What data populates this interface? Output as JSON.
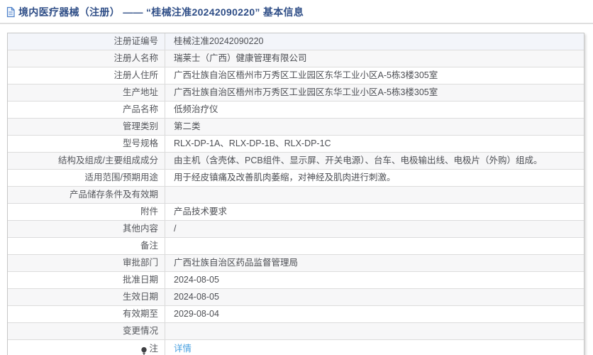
{
  "header": {
    "title": "境内医疗器械（注册） —— “桂械注准20242090220” 基本信息"
  },
  "table": {
    "rows": [
      {
        "label": "注册证编号",
        "value": "桂械注准20242090220"
      },
      {
        "label": "注册人名称",
        "value": "瑞莱士（广西）健康管理有限公司"
      },
      {
        "label": "注册人住所",
        "value": "广西壮族自治区梧州市万秀区工业园区东华工业小区A-5栋3楼305室"
      },
      {
        "label": "生产地址",
        "value": "广西壮族自治区梧州市万秀区工业园区东华工业小区A-5栋3楼305室"
      },
      {
        "label": "产品名称",
        "value": "低频治疗仪"
      },
      {
        "label": "管理类别",
        "value": "第二类"
      },
      {
        "label": "型号规格",
        "value": "RLX-DP-1A、RLX-DP-1B、RLX-DP-1C"
      },
      {
        "label": "结构及组成/主要组成成分",
        "value": "由主机（含壳体、PCB组件、显示屏、开关电源）、台车、电极输出线、电极片（外购）组成。"
      },
      {
        "label": "适用范围/预期用途",
        "value": "用于经皮镇痛及改善肌肉萎缩，对神经及肌肉进行刺激。"
      },
      {
        "label": "产品储存条件及有效期",
        "value": ""
      },
      {
        "label": "附件",
        "value": "产品技术要求"
      },
      {
        "label": "其他内容",
        "value": "/"
      },
      {
        "label": "备注",
        "value": ""
      },
      {
        "label": "审批部门",
        "value": "广西壮族自治区药品监督管理局"
      },
      {
        "label": "批准日期",
        "value": "2024-08-05"
      },
      {
        "label": "生效日期",
        "value": "2024-08-05"
      },
      {
        "label": "有效期至",
        "value": "2029-08-04"
      },
      {
        "label": "变更情况",
        "value": ""
      },
      {
        "label": "注",
        "value": "详情",
        "label_icon": "lightbulb-icon",
        "value_is_link": true
      }
    ]
  },
  "colors": {
    "title": "#2f4e87",
    "doc_icon": "#4d80c9",
    "link": "#4aa1e0",
    "row_alt": "#f7f7f8",
    "row_highlight": "#f3f5fa",
    "border": "#dcdcdc"
  }
}
